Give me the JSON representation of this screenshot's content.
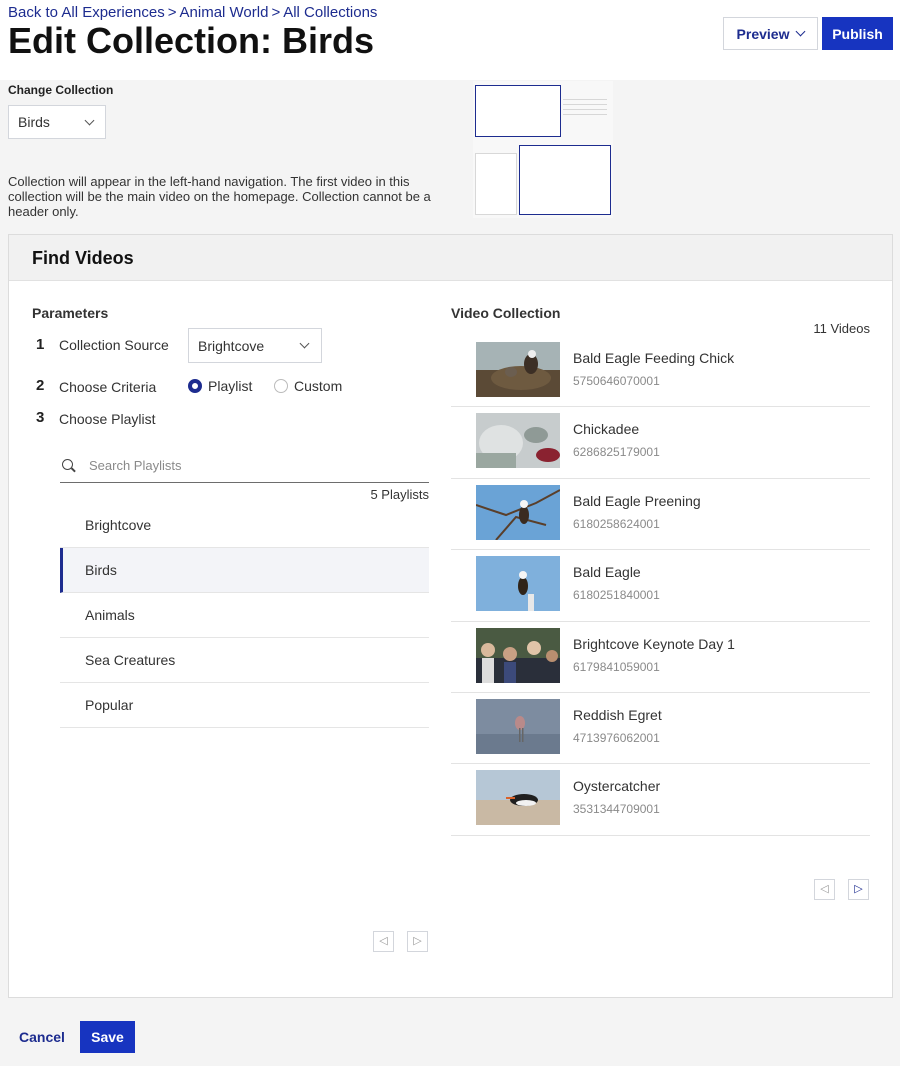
{
  "breadcrumb": {
    "items": [
      "Back to All Experiences",
      "Animal World",
      "All Collections"
    ],
    "separator": ">"
  },
  "page_title": "Edit Collection: Birds",
  "header": {
    "preview_label": "Preview",
    "publish_label": "Publish"
  },
  "change_collection": {
    "label": "Change Collection",
    "selected": "Birds",
    "description": "Collection will appear in the left-hand navigation. The first video in this collection will be the main video on the homepage. Collection cannot be a header only."
  },
  "find_videos": {
    "title": "Find Videos",
    "parameters_title": "Parameters",
    "steps": [
      {
        "num": "1",
        "label": "Collection Source"
      },
      {
        "num": "2",
        "label": "Choose Criteria"
      },
      {
        "num": "3",
        "label": "Choose Playlist"
      }
    ],
    "source_selected": "Brightcove",
    "criteria": {
      "options": [
        "Playlist",
        "Custom"
      ],
      "selected": "Playlist"
    },
    "search": {
      "placeholder": "Search Playlists",
      "value": ""
    },
    "playlist_count": "5 Playlists",
    "playlists": [
      "Brightcove",
      "Birds",
      "Animals",
      "Sea Creatures",
      "Popular"
    ],
    "active_playlist": "Birds"
  },
  "video_collection": {
    "title": "Video Collection",
    "count": "11 Videos",
    "videos": [
      {
        "name": "Bald Eagle Feeding Chick",
        "id": "5750646070001"
      },
      {
        "name": "Chickadee",
        "id": "6286825179001"
      },
      {
        "name": "Bald Eagle Preening",
        "id": "6180258624001"
      },
      {
        "name": "Bald Eagle",
        "id": "6180251840001"
      },
      {
        "name": "Brightcove Keynote Day 1",
        "id": "6179841059001"
      },
      {
        "name": "Reddish Egret",
        "id": "4713976062001"
      },
      {
        "name": "Oystercatcher",
        "id": "3531344709001"
      }
    ]
  },
  "footer": {
    "cancel_label": "Cancel",
    "save_label": "Save"
  },
  "colors": {
    "accent": "#1d2c8f",
    "primary_button": "#1734c0",
    "background": "#f4f4f4"
  },
  "icons": {
    "dropdown": "chevron-down-icon",
    "search": "search-icon",
    "prev": "triangle-left-icon",
    "next": "triangle-right-icon"
  }
}
